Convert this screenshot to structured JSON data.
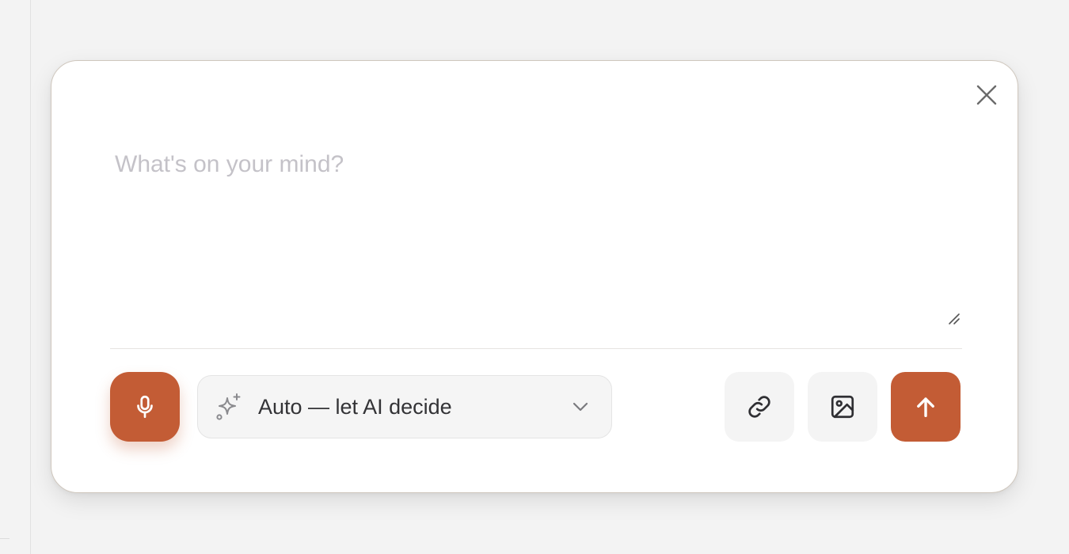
{
  "composer": {
    "placeholder": "What's on your mind?",
    "value": ""
  },
  "mode_select": {
    "selected_label": "Auto — let AI decide",
    "icon": "sparkle-icon"
  },
  "toolbar": {
    "mic_icon": "microphone-icon",
    "link_icon": "link-icon",
    "image_icon": "image-icon",
    "send_icon": "arrow-up-icon",
    "close_icon": "close-icon"
  },
  "colors": {
    "accent": "#c35c35",
    "background": "#f3f3f3",
    "modal": "#ffffff",
    "placeholder": "#c4c2c8"
  }
}
